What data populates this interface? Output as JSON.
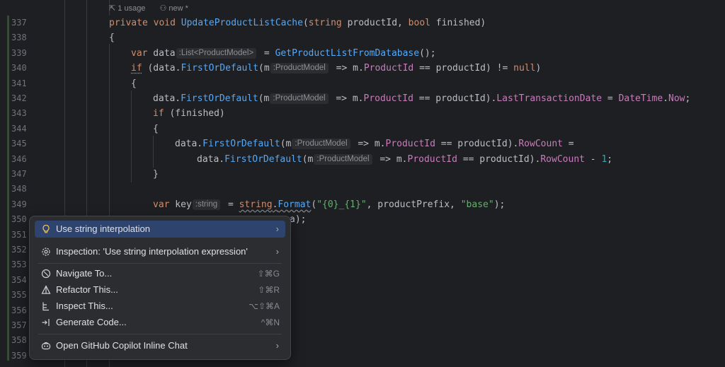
{
  "codelens": {
    "usages": "1 usage",
    "author": "new *"
  },
  "line_numbers": [
    "337",
    "338",
    "339",
    "340",
    "341",
    "342",
    "343",
    "344",
    "345",
    "346",
    "347",
    "348",
    "349",
    "350",
    "351",
    "352",
    "353",
    "354",
    "355",
    "356",
    "357",
    "358",
    "359"
  ],
  "code": {
    "l337": {
      "kw1": "private",
      "kw2": "void",
      "name": "UpdateProductListCache",
      "p1": "(",
      "t1": "string",
      "a1": " productId, ",
      "t2": "bool",
      "a2": " finished)"
    },
    "l338": "{",
    "l339": {
      "kw": "var",
      "v": " data",
      "hint": ":List<ProductModel>",
      "eq": " = ",
      "call": "GetProductListFromDatabase",
      "end": "();"
    },
    "l340": {
      "kw": "if",
      "a": " (data.",
      "call": "FirstOrDefault",
      "b": "(m",
      "hint": ":ProductModel",
      "c": " => m.",
      "prop": "ProductId",
      "d": " == productId) != ",
      "nul": "null",
      "e": ")"
    },
    "l341": "{",
    "l342": {
      "a": "data.",
      "call": "FirstOrDefault",
      "b": "(m",
      "hint": ":ProductModel",
      "c": " => m.",
      "prop": "ProductId",
      "d": " == productId).",
      "prop2": "LastTransactionDate",
      "e": " = ",
      "type": "DateTime",
      "f": ".",
      "prop3": "Now",
      "g": ";"
    },
    "l343": {
      "kw": "if",
      "a": " (finished)"
    },
    "l344": "{",
    "l345": {
      "a": "data.",
      "call": "FirstOrDefault",
      "b": "(m",
      "hint": ":ProductModel",
      "c": " => m.",
      "prop": "ProductId",
      "d": " == productId).",
      "prop2": "RowCount",
      "e": " ="
    },
    "l346": {
      "a": "data.",
      "call": "FirstOrDefault",
      "b": "(m",
      "hint": ":ProductModel",
      "c": " => m.",
      "prop": "ProductId",
      "d": " == productId).",
      "prop2": "RowCount",
      "e": " - ",
      "num": "1",
      "f": ";"
    },
    "l347": "}",
    "l349": {
      "kw": "var",
      "v": " key",
      "hint": ":string",
      "eq": " = ",
      "kw2": "string",
      "dot": ".",
      "call": "Format",
      "p": "(",
      "s1": "\"{0}_{1}\"",
      "mid": ", productPrefix, ",
      "s2": "\"base\"",
      "end": ");"
    },
    "l350": "a);"
  },
  "popup": {
    "items": [
      {
        "icon": "lightbulb-icon",
        "label": "Use string interpolation",
        "submenu": true
      },
      {
        "icon": "gear-icon",
        "label": "Inspection: 'Use string interpolation expression'",
        "submenu": true
      },
      {
        "icon": "navigate-icon",
        "label": "Navigate To...",
        "shortcut": "⇧⌘G"
      },
      {
        "icon": "refactor-icon",
        "label": "Refactor This...",
        "shortcut": "⇧⌘R"
      },
      {
        "icon": "inspect-icon",
        "label": "Inspect This...",
        "shortcut": "⌥⇧⌘A"
      },
      {
        "icon": "generate-icon",
        "label": "Generate Code...",
        "shortcut": "^⌘N"
      },
      {
        "icon": "copilot-icon",
        "label": "Open GitHub Copilot Inline Chat",
        "submenu": true
      }
    ],
    "submenu_arrow": "›"
  },
  "colors": {
    "background": "#1e1f22",
    "keyword": "#cf8e6d",
    "method": "#56a8f5",
    "property": "#c77dbb",
    "string": "#6aab73",
    "selection": "#2e436e"
  }
}
